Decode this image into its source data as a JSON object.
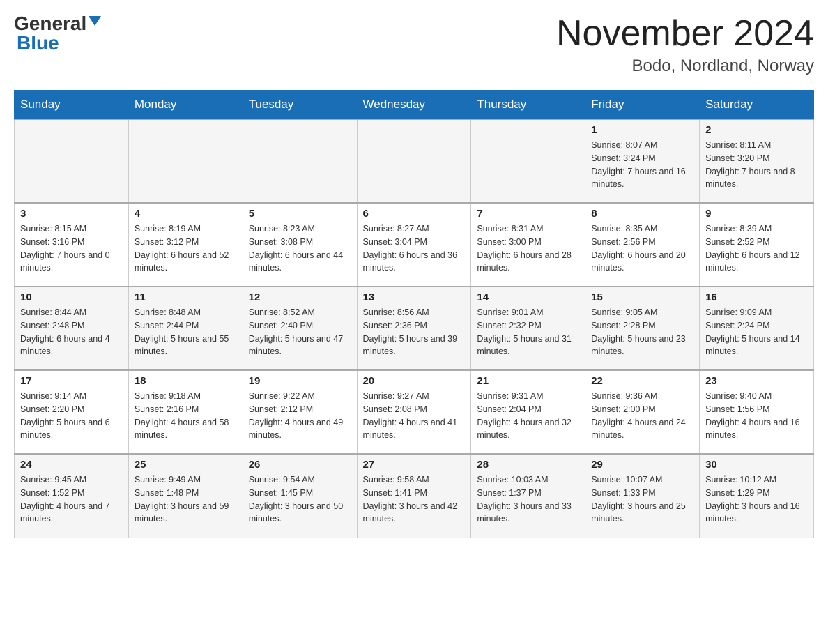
{
  "logo": {
    "general": "General",
    "blue": "Blue"
  },
  "title": "November 2024",
  "subtitle": "Bodo, Nordland, Norway",
  "weekdays": [
    "Sunday",
    "Monday",
    "Tuesday",
    "Wednesday",
    "Thursday",
    "Friday",
    "Saturday"
  ],
  "weeks": [
    [
      {
        "day": "",
        "info": ""
      },
      {
        "day": "",
        "info": ""
      },
      {
        "day": "",
        "info": ""
      },
      {
        "day": "",
        "info": ""
      },
      {
        "day": "",
        "info": ""
      },
      {
        "day": "1",
        "info": "Sunrise: 8:07 AM\nSunset: 3:24 PM\nDaylight: 7 hours and 16 minutes."
      },
      {
        "day": "2",
        "info": "Sunrise: 8:11 AM\nSunset: 3:20 PM\nDaylight: 7 hours and 8 minutes."
      }
    ],
    [
      {
        "day": "3",
        "info": "Sunrise: 8:15 AM\nSunset: 3:16 PM\nDaylight: 7 hours and 0 minutes."
      },
      {
        "day": "4",
        "info": "Sunrise: 8:19 AM\nSunset: 3:12 PM\nDaylight: 6 hours and 52 minutes."
      },
      {
        "day": "5",
        "info": "Sunrise: 8:23 AM\nSunset: 3:08 PM\nDaylight: 6 hours and 44 minutes."
      },
      {
        "day": "6",
        "info": "Sunrise: 8:27 AM\nSunset: 3:04 PM\nDaylight: 6 hours and 36 minutes."
      },
      {
        "day": "7",
        "info": "Sunrise: 8:31 AM\nSunset: 3:00 PM\nDaylight: 6 hours and 28 minutes."
      },
      {
        "day": "8",
        "info": "Sunrise: 8:35 AM\nSunset: 2:56 PM\nDaylight: 6 hours and 20 minutes."
      },
      {
        "day": "9",
        "info": "Sunrise: 8:39 AM\nSunset: 2:52 PM\nDaylight: 6 hours and 12 minutes."
      }
    ],
    [
      {
        "day": "10",
        "info": "Sunrise: 8:44 AM\nSunset: 2:48 PM\nDaylight: 6 hours and 4 minutes."
      },
      {
        "day": "11",
        "info": "Sunrise: 8:48 AM\nSunset: 2:44 PM\nDaylight: 5 hours and 55 minutes."
      },
      {
        "day": "12",
        "info": "Sunrise: 8:52 AM\nSunset: 2:40 PM\nDaylight: 5 hours and 47 minutes."
      },
      {
        "day": "13",
        "info": "Sunrise: 8:56 AM\nSunset: 2:36 PM\nDaylight: 5 hours and 39 minutes."
      },
      {
        "day": "14",
        "info": "Sunrise: 9:01 AM\nSunset: 2:32 PM\nDaylight: 5 hours and 31 minutes."
      },
      {
        "day": "15",
        "info": "Sunrise: 9:05 AM\nSunset: 2:28 PM\nDaylight: 5 hours and 23 minutes."
      },
      {
        "day": "16",
        "info": "Sunrise: 9:09 AM\nSunset: 2:24 PM\nDaylight: 5 hours and 14 minutes."
      }
    ],
    [
      {
        "day": "17",
        "info": "Sunrise: 9:14 AM\nSunset: 2:20 PM\nDaylight: 5 hours and 6 minutes."
      },
      {
        "day": "18",
        "info": "Sunrise: 9:18 AM\nSunset: 2:16 PM\nDaylight: 4 hours and 58 minutes."
      },
      {
        "day": "19",
        "info": "Sunrise: 9:22 AM\nSunset: 2:12 PM\nDaylight: 4 hours and 49 minutes."
      },
      {
        "day": "20",
        "info": "Sunrise: 9:27 AM\nSunset: 2:08 PM\nDaylight: 4 hours and 41 minutes."
      },
      {
        "day": "21",
        "info": "Sunrise: 9:31 AM\nSunset: 2:04 PM\nDaylight: 4 hours and 32 minutes."
      },
      {
        "day": "22",
        "info": "Sunrise: 9:36 AM\nSunset: 2:00 PM\nDaylight: 4 hours and 24 minutes."
      },
      {
        "day": "23",
        "info": "Sunrise: 9:40 AM\nSunset: 1:56 PM\nDaylight: 4 hours and 16 minutes."
      }
    ],
    [
      {
        "day": "24",
        "info": "Sunrise: 9:45 AM\nSunset: 1:52 PM\nDaylight: 4 hours and 7 minutes."
      },
      {
        "day": "25",
        "info": "Sunrise: 9:49 AM\nSunset: 1:48 PM\nDaylight: 3 hours and 59 minutes."
      },
      {
        "day": "26",
        "info": "Sunrise: 9:54 AM\nSunset: 1:45 PM\nDaylight: 3 hours and 50 minutes."
      },
      {
        "day": "27",
        "info": "Sunrise: 9:58 AM\nSunset: 1:41 PM\nDaylight: 3 hours and 42 minutes."
      },
      {
        "day": "28",
        "info": "Sunrise: 10:03 AM\nSunset: 1:37 PM\nDaylight: 3 hours and 33 minutes."
      },
      {
        "day": "29",
        "info": "Sunrise: 10:07 AM\nSunset: 1:33 PM\nDaylight: 3 hours and 25 minutes."
      },
      {
        "day": "30",
        "info": "Sunrise: 10:12 AM\nSunset: 1:29 PM\nDaylight: 3 hours and 16 minutes."
      }
    ]
  ]
}
